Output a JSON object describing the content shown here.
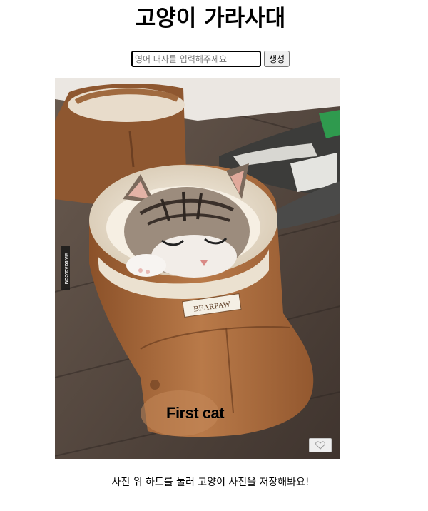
{
  "header": {
    "title": "고양이 가라사대"
  },
  "form": {
    "input_placeholder": "영어 대사를 입력해주세요",
    "submit_label": "생성"
  },
  "cat_card": {
    "caption": "First cat",
    "watermark": "VIA 9GAG.COM",
    "boot_label": "BEARPAW",
    "favorite_icon": "heart-icon"
  },
  "hint": "사진 위 하트를 눌러 고양이 사진을 저장해봐요!",
  "colors": {
    "boot": "#a4683b",
    "floor": "#5b4a3f",
    "fur": "#efe6d6"
  }
}
